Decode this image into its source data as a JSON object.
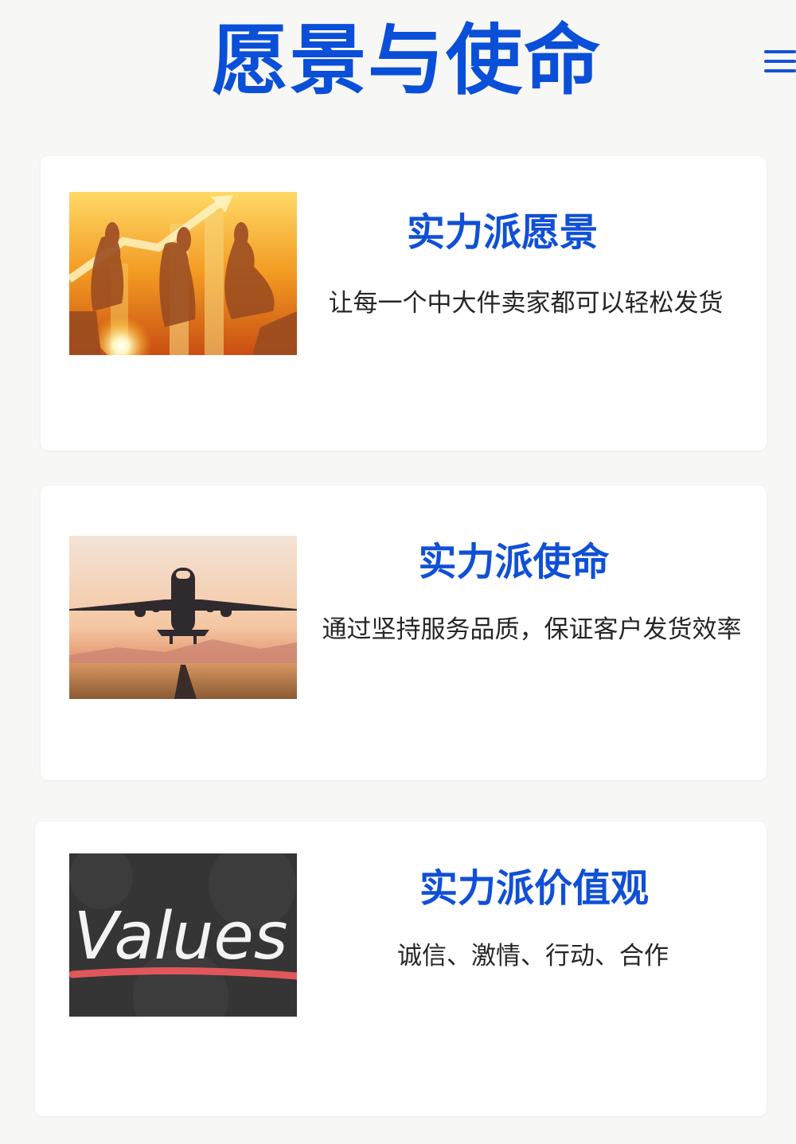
{
  "header": {
    "title": "愿景与使命",
    "menu_icon": "hamburger-menu-icon",
    "accent_color": "#0a4fd8"
  },
  "cards": [
    {
      "title": "实力派愿景",
      "text": "让每一个中大件卖家都可以轻松发货",
      "image": "thumbs-up-growth-image"
    },
    {
      "title": "实力派使命",
      "text": "通过坚持服务品质，保证客户发货效率",
      "image": "airplane-takeoff-image"
    },
    {
      "title": "实力派价值观",
      "text": "诚信、激情、行动、合作",
      "image": "values-chalkboard-image",
      "image_text": "Values"
    }
  ]
}
